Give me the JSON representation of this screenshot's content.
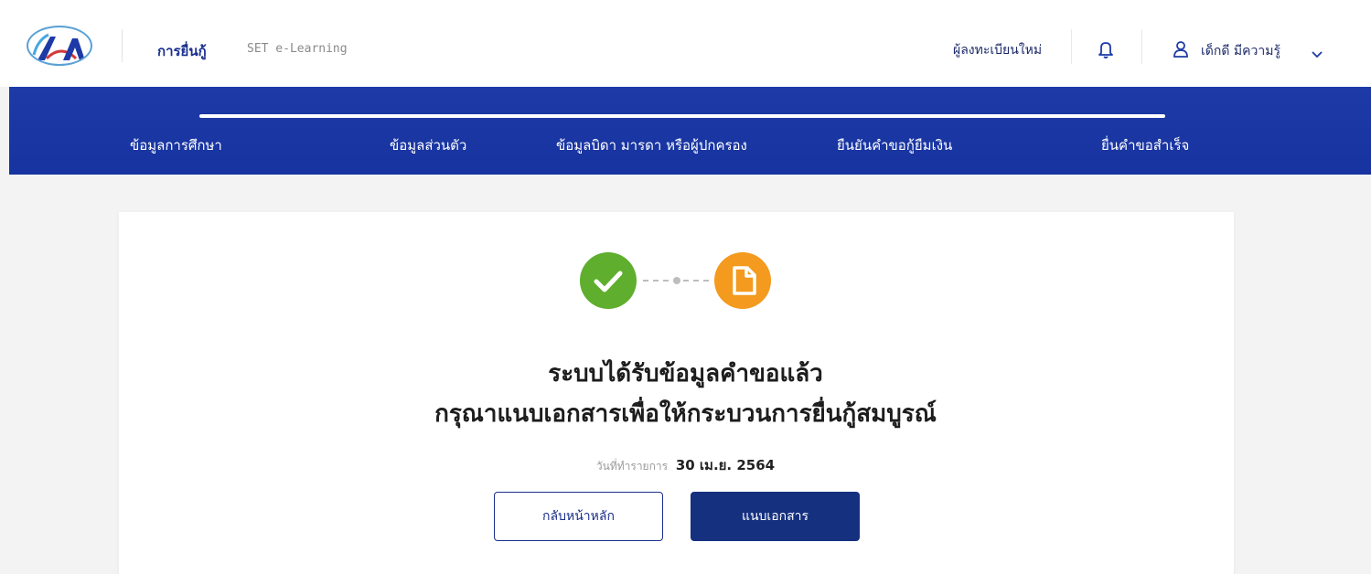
{
  "header": {
    "nav_loan": "การยื่นกู้",
    "nav_elearning": "SET e-Learning",
    "register_link": "ผู้ลงทะเบียนใหม่",
    "user_name": "เด็กดี มีความรู้"
  },
  "stepper": {
    "steps": [
      "ข้อมูลการศึกษา",
      "ข้อมูลส่วนตัว",
      "ข้อมูลบิดา มารดา หรือผู้ปกครอง",
      "ยืนยันคำขอกู้ยืมเงิน",
      "ยื่นคำขอสำเร็จ"
    ]
  },
  "result": {
    "title_line1": "ระบบได้รับข้อมูลคำขอแล้ว",
    "title_line2": "กรุณาแนบเอกสารเพื่อให้กระบวนการยื่นกู้สมบูรณ์",
    "date_label": "วันที่ทำรายการ",
    "date_value": "30 เม.ย. 2564",
    "back_button": "กลับหน้าหลัก",
    "attach_button": "แนบเอกสาร"
  },
  "icons": {
    "logo": "agency-logo",
    "bell": "bell-icon",
    "user": "user-icon",
    "chevron": "chevron-down-icon",
    "success": "check-circle-icon",
    "document": "document-icon"
  },
  "colors": {
    "brand_blue": "#1d3aa6",
    "button_blue": "#15307f",
    "success_green": "#5fae2e",
    "pending_orange": "#f39a1f"
  }
}
